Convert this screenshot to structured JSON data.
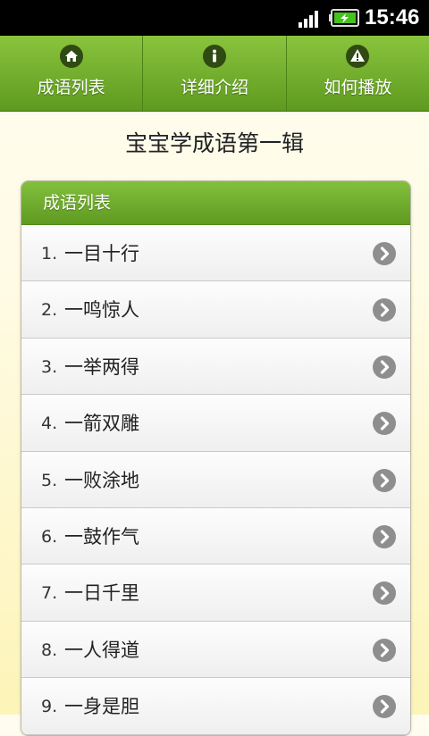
{
  "status_bar": {
    "time": "15:46",
    "icons": [
      "signal-icon",
      "battery-charging-icon"
    ]
  },
  "tabs": [
    {
      "label": "成语列表",
      "icon": "home-icon"
    },
    {
      "label": "详细介绍",
      "icon": "info-icon"
    },
    {
      "label": "如何播放",
      "icon": "warning-icon"
    }
  ],
  "page_title": "宝宝学成语第一辑",
  "list": {
    "header": "成语列表",
    "items": [
      {
        "num": "1.",
        "name": "一目十行"
      },
      {
        "num": "2.",
        "name": "一鸣惊人"
      },
      {
        "num": "3.",
        "name": "一举两得"
      },
      {
        "num": "4.",
        "name": "一箭双雕"
      },
      {
        "num": "5.",
        "name": "一败涂地"
      },
      {
        "num": "6.",
        "name": "一鼓作气"
      },
      {
        "num": "7.",
        "name": "一日千里"
      },
      {
        "num": "8.",
        "name": "一人得道"
      },
      {
        "num": "9.",
        "name": "一身是胆"
      }
    ]
  },
  "colors": {
    "accent_green": "#6aaa2a",
    "chevron_gray": "#8e8e8e"
  }
}
